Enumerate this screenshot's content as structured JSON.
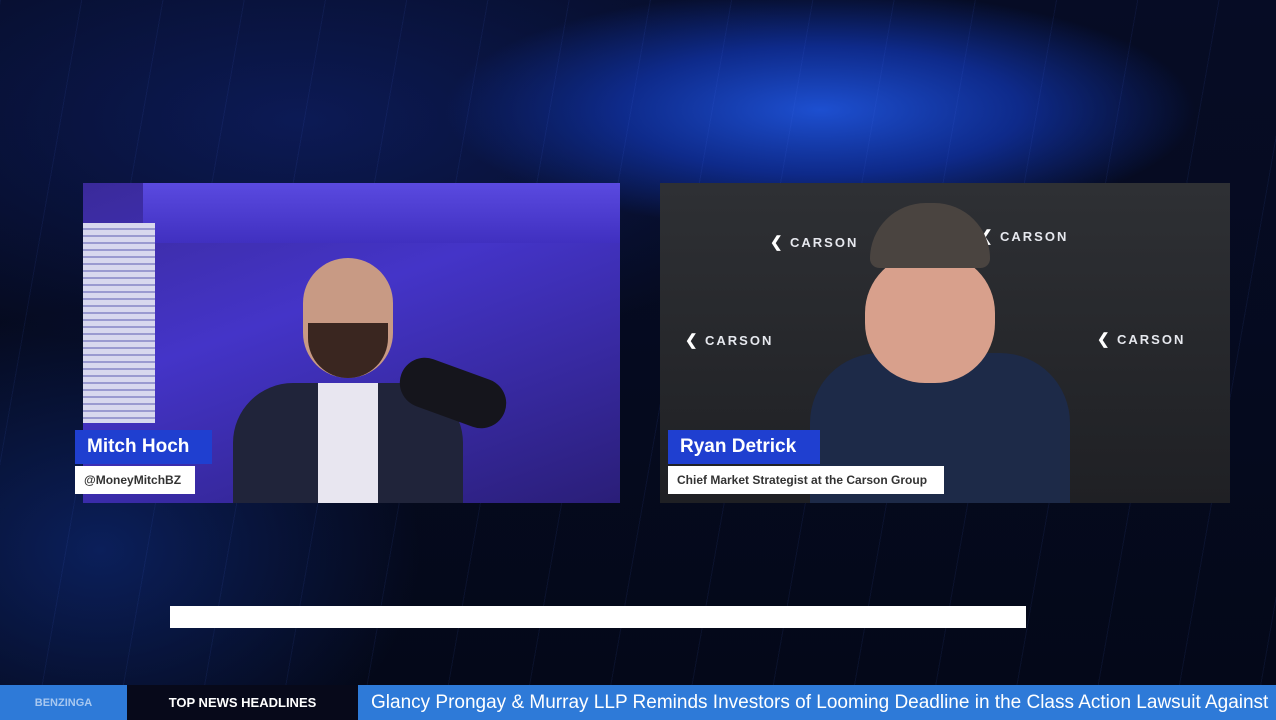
{
  "guests": [
    {
      "name": "Mitch Hoch",
      "subtitle": "@MoneyMitchBZ"
    },
    {
      "name": "Ryan Detrick",
      "subtitle": "Chief Market Strategist at the Carson Group"
    }
  ],
  "backdrop_logo": "CARSON",
  "ticker": {
    "brand": "BENZINGA",
    "label": "TOP NEWS HEADLINES",
    "headline": "Glancy Prongay & Murray LLP Reminds Investors of Looming Deadline in the Class Action Lawsuit Against"
  },
  "colors": {
    "name_tag": "#1f3fd0",
    "ticker_blue": "#2e7ad8",
    "background": "#050a1e"
  }
}
